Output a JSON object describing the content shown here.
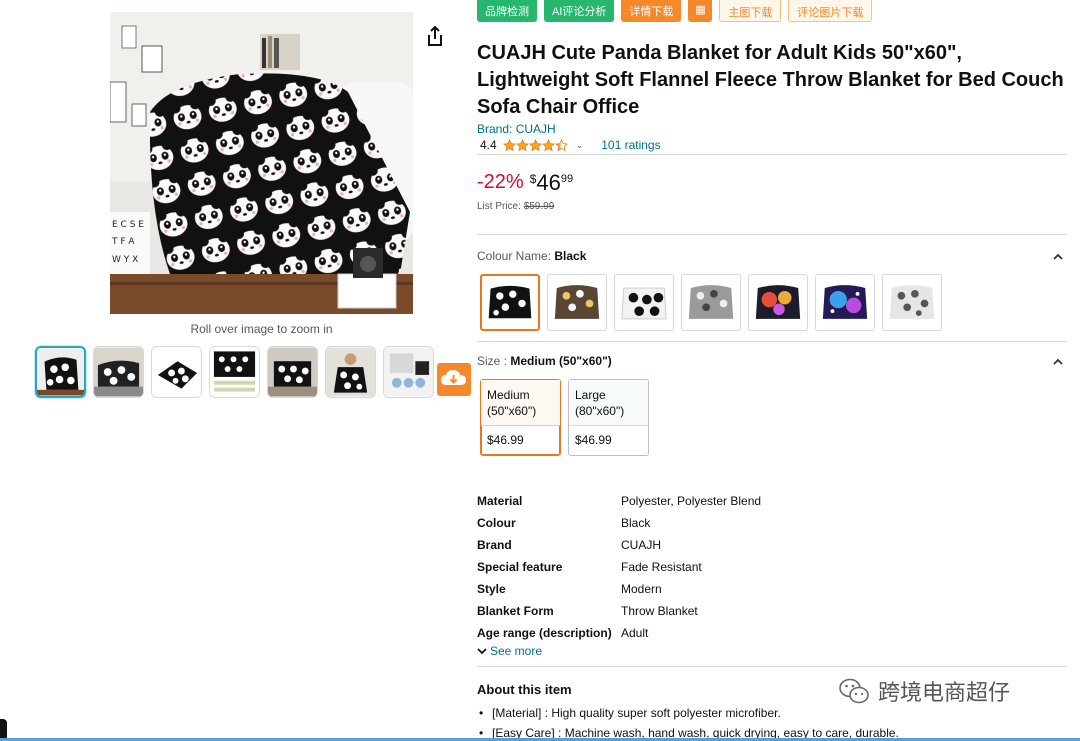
{
  "plugin_toolbar": {
    "buttons": [
      "品牌检测",
      "AI评论分析",
      "详情下载",
      "",
      "主图下载",
      "评论图片下载"
    ]
  },
  "gallery": {
    "zoom_hint": "Roll over image to zoom in",
    "thumbnail_count": 7
  },
  "product": {
    "title": "CUAJH Cute Panda Blanket for Adult Kids 50\"x60\", Lightweight Soft Flannel Fleece Throw Blanket for Bed Couch Sofa Chair Office",
    "brand_link": "Brand: CUAJH",
    "rating_value": "4.4",
    "rating_stars": 4.4,
    "ratings_count": "101 ratings",
    "discount": "-22%",
    "currency": "$",
    "price_whole": "46",
    "price_fraction": "99",
    "list_price_label": "List Price:",
    "list_price": "$59.99"
  },
  "colour": {
    "label": "Colour Name:",
    "selected": "Black",
    "swatch_count": 7
  },
  "size": {
    "label": "Size :",
    "selected": "Medium (50\"x60\")",
    "options": [
      {
        "line1": "Medium",
        "line2": "(50\"x60\")",
        "price": "$46.99"
      },
      {
        "line1": "Large",
        "line2": "(80\"x60\")",
        "price": "$46.99"
      }
    ]
  },
  "specs": [
    {
      "key": "Material",
      "value": "Polyester, Polyester Blend"
    },
    {
      "key": "Colour",
      "value": "Black"
    },
    {
      "key": "Brand",
      "value": "CUAJH"
    },
    {
      "key": "Special feature",
      "value": "Fade Resistant"
    },
    {
      "key": "Style",
      "value": "Modern"
    },
    {
      "key": "Blanket Form",
      "value": "Throw Blanket"
    },
    {
      "key": "Age range (description)",
      "value": "Adult"
    }
  ],
  "see_more": "See more",
  "about": {
    "title": "About this item",
    "bullets": [
      "[Material] : High quality super soft polyester microfiber.",
      "[Easy Care] : Machine wash, hand wash, quick drying, easy to care, durable."
    ]
  },
  "watermark": "跨境电商超仔",
  "colors": {
    "link": "#007185",
    "discount": "#cc0c39",
    "star": "#ffa41c",
    "accent_orange": "#f5892a",
    "plugin_green": "#27b66e"
  }
}
